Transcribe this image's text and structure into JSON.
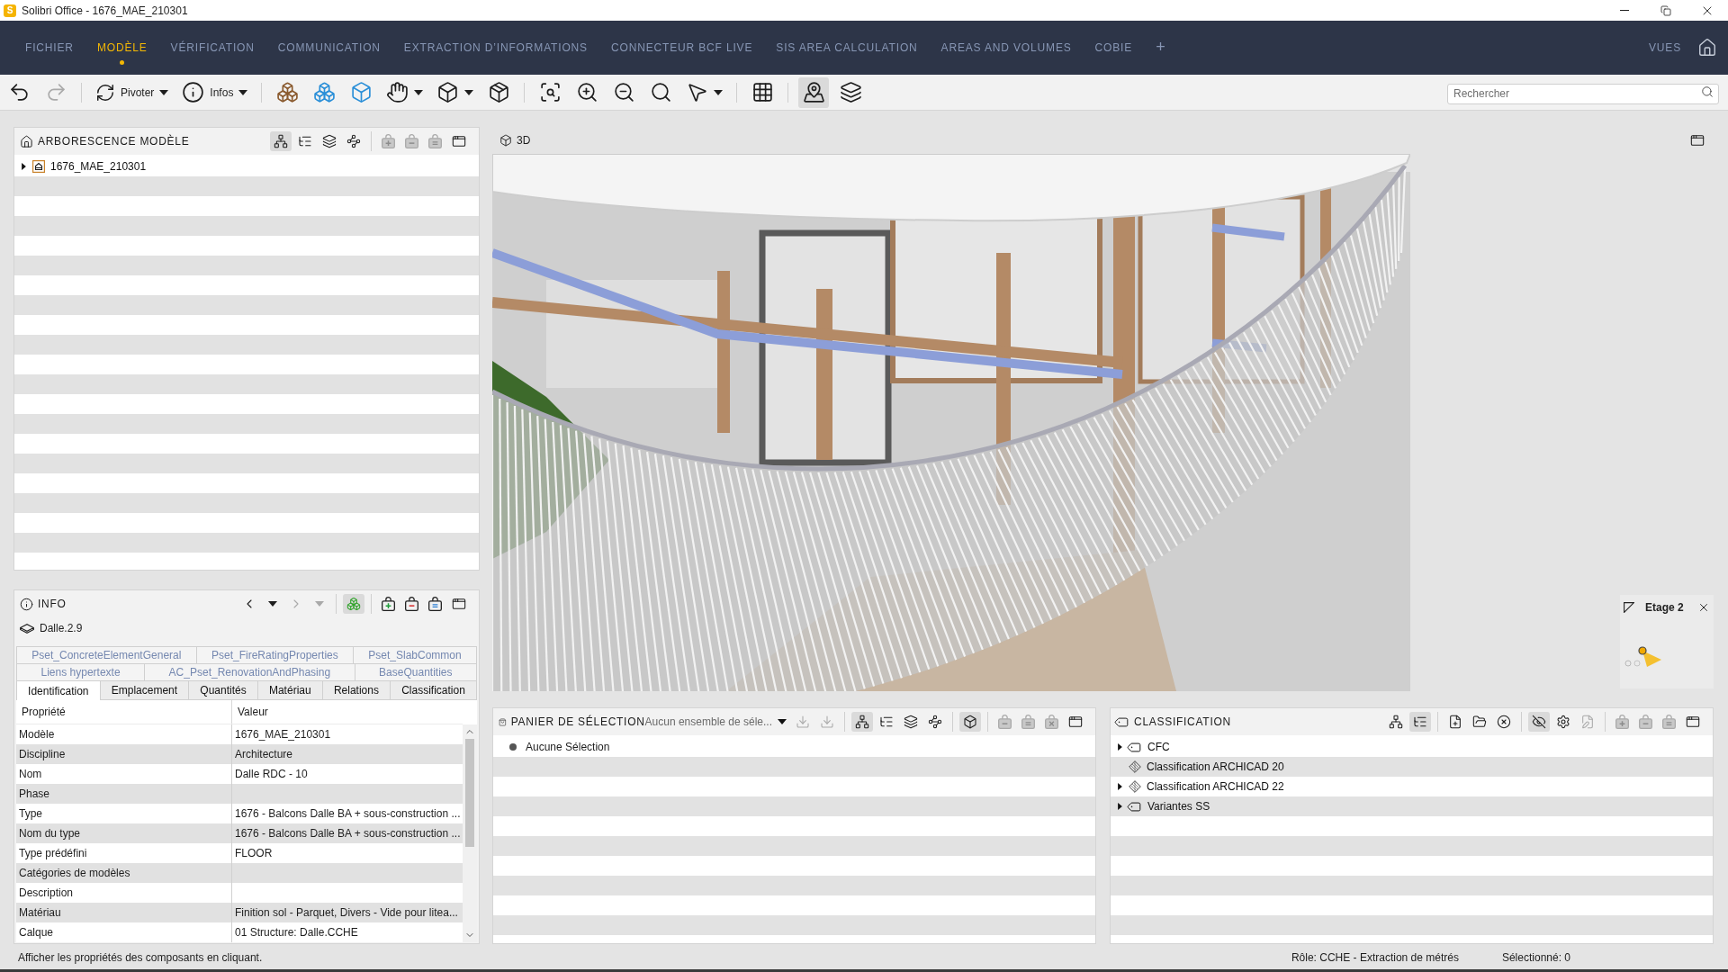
{
  "window": {
    "logo": "S",
    "title": "Solibri Office - 1676_MAE_210301"
  },
  "menu": {
    "items": [
      {
        "label": "FICHIER",
        "selected": false
      },
      {
        "label": "MODÈLE",
        "selected": true
      },
      {
        "label": "VÉRIFICATION",
        "selected": false
      },
      {
        "label": "COMMUNICATION",
        "selected": false
      },
      {
        "label": "EXTRACTION D’INFORMATIONS",
        "selected": false
      },
      {
        "label": "CONNECTEUR BCF LIVE",
        "selected": false
      },
      {
        "label": "SIS AREA CALCULATION",
        "selected": false
      },
      {
        "label": "AREAS AND VOLUMES",
        "selected": false
      },
      {
        "label": "COBIE",
        "selected": false
      }
    ],
    "add_label": "+",
    "views_label": "VUES"
  },
  "toolbar": {
    "buttons": [
      {
        "pressed": false,
        "disabled": false
      },
      {
        "pressed": false,
        "disabled": true
      },
      {
        "label": "Pivoter",
        "pressed": false,
        "disabled": false
      },
      {
        "label": "Infos",
        "pressed": false,
        "disabled": false
      },
      {
        "pressed": false,
        "disabled": false
      },
      {
        "pressed": false,
        "disabled": false
      },
      {
        "pressed": false,
        "disabled": false
      },
      {
        "pressed": false,
        "disabled": false
      },
      {
        "pressed": false,
        "disabled": false
      },
      {
        "pressed": false,
        "disabled": false
      },
      {
        "pressed": false,
        "disabled": false
      },
      {
        "pressed": false,
        "disabled": false
      },
      {
        "pressed": false,
        "disabled": false
      },
      {
        "pressed": false,
        "disabled": false
      },
      {
        "pressed": false,
        "disabled": false
      },
      {
        "pressed": false,
        "disabled": false
      },
      {
        "pressed": true,
        "disabled": false
      },
      {
        "pressed": false,
        "disabled": false
      }
    ],
    "search": {
      "placeholder": "Rechercher"
    }
  },
  "model_tree": {
    "title": "ARBORESCENCE MODÈLE",
    "tools": [
      {
        "pressed": true,
        "disabled": false
      },
      {
        "pressed": false,
        "disabled": false
      },
      {
        "pressed": false,
        "disabled": false
      },
      {
        "pressed": false,
        "disabled": false
      },
      {
        "pressed": false,
        "disabled": true
      },
      {
        "pressed": false,
        "disabled": true
      },
      {
        "pressed": false,
        "disabled": true
      },
      {
        "pressed": false,
        "disabled": false
      }
    ],
    "items": [
      {
        "label": "1676_MAE_210301",
        "has_children": true,
        "expanded": false
      }
    ]
  },
  "viewport": {
    "title": "3D",
    "floor_map": {
      "title": "Etage 2"
    }
  },
  "info": {
    "title": "INFO",
    "tools": [
      {
        "pressed": false,
        "disabled": false
      },
      {
        "pressed": false,
        "disabled": false
      },
      {
        "pressed": false,
        "disabled": true
      },
      {
        "pressed": false,
        "disabled": true
      },
      {
        "pressed": true,
        "disabled": false
      },
      {
        "pressed": false,
        "disabled": false
      },
      {
        "pressed": false,
        "disabled": false
      },
      {
        "pressed": false,
        "disabled": false
      },
      {
        "pressed": false,
        "disabled": false
      }
    ],
    "element": "Dalle.2.9",
    "tab_rows": [
      [
        {
          "label": "Pset_ConcreteElementGeneral",
          "selected": false
        },
        {
          "label": "Pset_FireRatingProperties",
          "selected": false
        },
        {
          "label": "Pset_SlabCommon",
          "selected": false
        }
      ],
      [
        {
          "label": "Liens hypertexte",
          "selected": false
        },
        {
          "label": "AC_Pset_RenovationAndPhasing",
          "selected": false
        },
        {
          "label": "BaseQuantities",
          "selected": false
        }
      ],
      [
        {
          "label": "Identification",
          "selected": true
        },
        {
          "label": "Emplacement",
          "selected": false
        },
        {
          "label": "Quantités",
          "selected": false
        },
        {
          "label": "Matériau",
          "selected": false
        },
        {
          "label": "Relations",
          "selected": false
        },
        {
          "label": "Classification",
          "selected": false
        }
      ]
    ],
    "table": {
      "columns": [
        "Propriété",
        "Valeur"
      ],
      "rows": [
        {
          "property": "Modèle",
          "value": "1676_MAE_210301"
        },
        {
          "property": "Discipline",
          "value": "Architecture"
        },
        {
          "property": "Nom",
          "value": "Dalle RDC - 10"
        },
        {
          "property": "Phase"
        },
        {
          "property": "Type",
          "value": "1676 - Balcons Dalle BA + sous-construction ..."
        },
        {
          "property": "Nom du type",
          "value": "1676 - Balcons Dalle BA + sous-construction ..."
        },
        {
          "property": "Type prédéfini",
          "value": "FLOOR"
        },
        {
          "property": "Catégories de modèles"
        },
        {
          "property": "Description"
        },
        {
          "property": "Matériau",
          "value": "Finition sol - Parquet, Divers - Vide pour litea..."
        },
        {
          "property": "Calque",
          "value": "01 Structure: Dalle.CCHE"
        }
      ]
    }
  },
  "selection_basket": {
    "title": "PANIER DE SÉLECTION",
    "set_dropdown": "Aucun ensemble de séle...",
    "tools": [
      {
        "pressed": false,
        "disabled": true
      },
      {
        "pressed": false,
        "disabled": true
      },
      {
        "pressed": true,
        "disabled": false
      },
      {
        "pressed": false,
        "disabled": false
      },
      {
        "pressed": false,
        "disabled": false
      },
      {
        "pressed": false,
        "disabled": false
      },
      {
        "pressed": true,
        "disabled": false
      },
      {
        "pressed": false,
        "disabled": true
      },
      {
        "pressed": false,
        "disabled": true
      },
      {
        "pressed": false,
        "disabled": true
      },
      {
        "pressed": false,
        "disabled": false
      }
    ],
    "items": [
      {
        "label": "Aucune Sélection"
      }
    ]
  },
  "classification": {
    "title": "CLASSIFICATION",
    "tools": [
      {
        "pressed": false,
        "disabled": false
      },
      {
        "pressed": true,
        "disabled": false
      },
      {
        "pressed": false,
        "disabled": false
      },
      {
        "pressed": false,
        "disabled": false
      },
      {
        "pressed": false,
        "disabled": false
      },
      {
        "pressed": true,
        "disabled": false
      },
      {
        "pressed": false,
        "disabled": false
      },
      {
        "pressed": false,
        "disabled": true
      },
      {
        "pressed": false,
        "disabled": true
      },
      {
        "pressed": false,
        "disabled": true
      },
      {
        "pressed": false,
        "disabled": true
      },
      {
        "pressed": false,
        "disabled": false
      }
    ],
    "items": [
      {
        "label": "CFC",
        "kind": "tag",
        "has_children": true,
        "expanded": false
      },
      {
        "label": "Classification ARCHICAD 20",
        "kind": "diamond",
        "has_children": false
      },
      {
        "label": "Classification ARCHICAD 22",
        "kind": "diamond",
        "has_children": true,
        "expanded": false
      },
      {
        "label": "Variantes SS",
        "kind": "tag",
        "has_children": true,
        "expanded": false
      }
    ]
  },
  "status_bar": {
    "hint": "Afficher les propriétés des composants en cliquant.",
    "role": "Rôle: CCHE - Extraction de métrés",
    "selected_count": "Sélectionné: 0"
  }
}
